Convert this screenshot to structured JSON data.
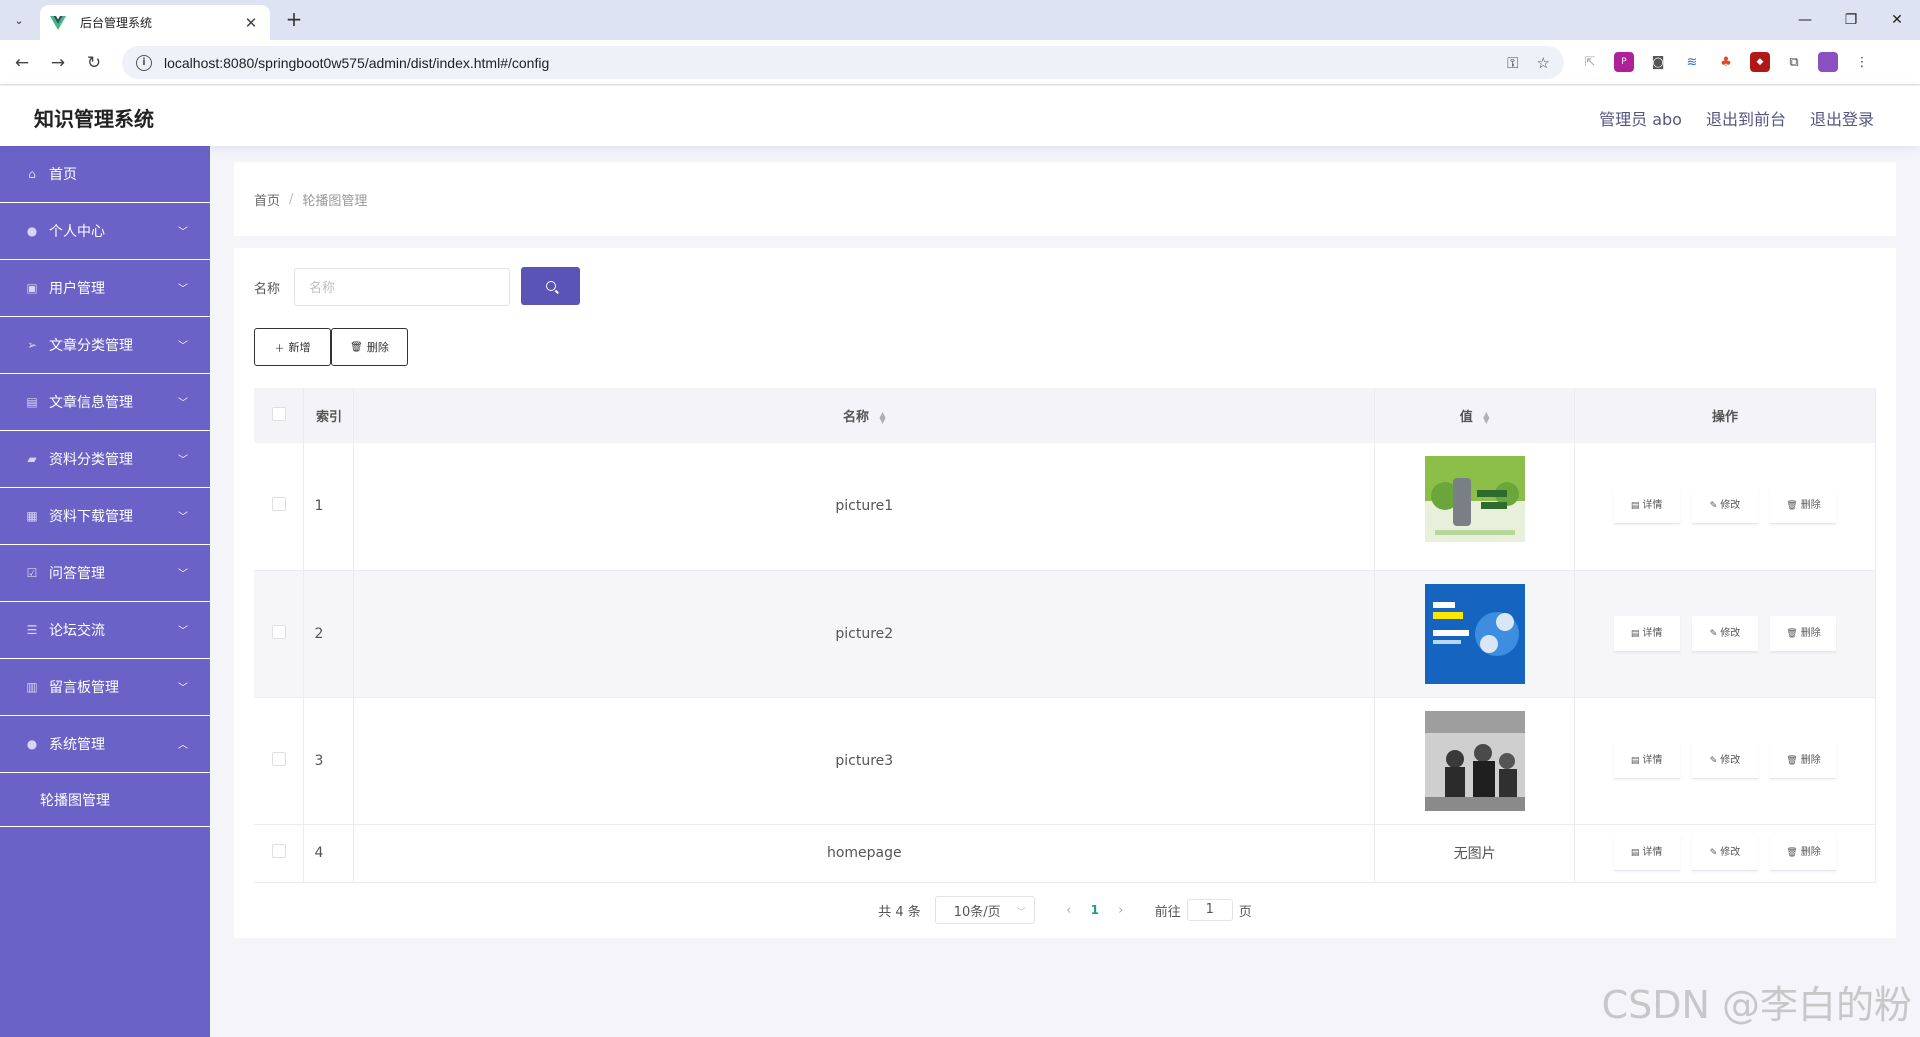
{
  "browser": {
    "tab_title": "后台管理系统",
    "url": "localhost:8080/springboot0w575/admin/dist/index.html#/config"
  },
  "header": {
    "title": "知识管理系统",
    "links": [
      "管理员 abo",
      "退出到前台",
      "退出登录"
    ]
  },
  "sidebar": {
    "items": [
      {
        "label": "首页",
        "icon": "home-icon",
        "expandable": false
      },
      {
        "label": "个人中心",
        "icon": "user-icon",
        "expandable": true
      },
      {
        "label": "用户管理",
        "icon": "clipboard-icon",
        "expandable": true
      },
      {
        "label": "文章分类管理",
        "icon": "send-icon",
        "expandable": true
      },
      {
        "label": "文章信息管理",
        "icon": "picture-icon",
        "expandable": true
      },
      {
        "label": "资料分类管理",
        "icon": "thumb-icon",
        "expandable": true
      },
      {
        "label": "资料下载管理",
        "icon": "grid-icon",
        "expandable": true
      },
      {
        "label": "问答管理",
        "icon": "check-icon",
        "expandable": true
      },
      {
        "label": "论坛交流",
        "icon": "list-icon",
        "expandable": true
      },
      {
        "label": "留言板管理",
        "icon": "chart-icon",
        "expandable": true
      },
      {
        "label": "系统管理",
        "icon": "user-icon",
        "expandable": true,
        "expanded": true
      }
    ],
    "submenu": [
      "轮播图管理"
    ]
  },
  "breadcrumb": {
    "home": "首页",
    "separator": "/",
    "current": "轮播图管理"
  },
  "search": {
    "label": "名称",
    "placeholder": "名称"
  },
  "actions": {
    "add": "新增",
    "delete": "删除"
  },
  "table": {
    "columns": {
      "index": "索引",
      "name": "名称",
      "value": "值",
      "ops": "操作"
    },
    "op_labels": {
      "detail": "详情",
      "edit": "修改",
      "delete": "删除"
    },
    "no_image": "无图片",
    "rows": [
      {
        "index": "1",
        "name": "picture1",
        "image": "green"
      },
      {
        "index": "2",
        "name": "picture2",
        "image": "blue"
      },
      {
        "index": "3",
        "name": "picture3",
        "image": "gray"
      },
      {
        "index": "4",
        "name": "homepage",
        "image": ""
      }
    ]
  },
  "pagination": {
    "total": "共 4 条",
    "page_size": "10条/页",
    "current_page": "1",
    "goto_label": "前往",
    "goto_value": "1",
    "page_suffix": "页"
  },
  "watermark": "CSDN @李白的粉",
  "colors": {
    "sidebar": "#6a62c6",
    "primary_button": "#5a54b8",
    "page_active": "#1e9e8a"
  }
}
